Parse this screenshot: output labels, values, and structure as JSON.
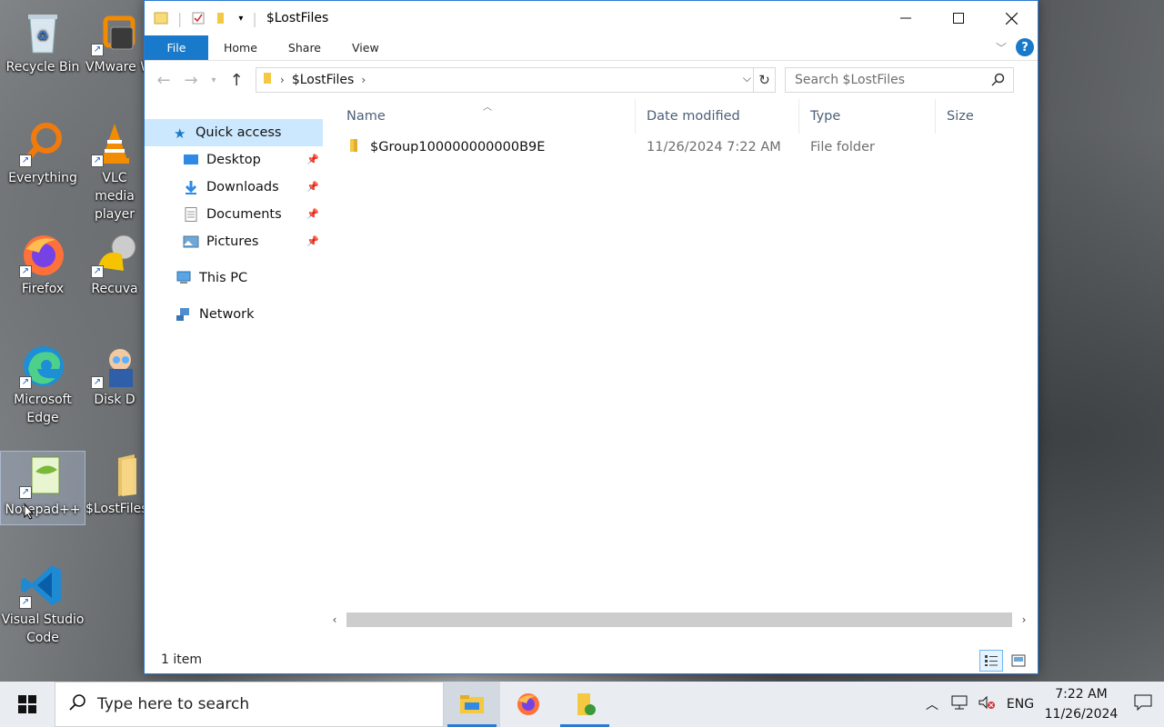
{
  "desktop": {
    "icons": [
      {
        "label": "Recycle Bin"
      },
      {
        "label": "VMware Workstation"
      },
      {
        "label": "Everything"
      },
      {
        "label": "VLC media player"
      },
      {
        "label": "Firefox"
      },
      {
        "label": "Recuva"
      },
      {
        "label": "Microsoft Edge"
      },
      {
        "label": "Disk D"
      },
      {
        "label": "Notepad++"
      },
      {
        "label": "$LostFiles"
      },
      {
        "label": "Visual Studio Code"
      }
    ]
  },
  "window": {
    "title": "$LostFiles",
    "ribbon_tabs": [
      "File",
      "Home",
      "Share",
      "View"
    ],
    "address": {
      "crumb": "$LostFiles"
    },
    "search_placeholder": "Search $LostFiles",
    "nav": {
      "quick_access": "Quick access",
      "pinned": [
        "Desktop",
        "Downloads",
        "Documents",
        "Pictures"
      ],
      "this_pc": "This PC",
      "network": "Network"
    },
    "columns": [
      "Name",
      "Date modified",
      "Type",
      "Size"
    ],
    "files": [
      {
        "name": "$Group100000000000B9E",
        "date": "11/26/2024 7:22 AM",
        "type": "File folder",
        "size": ""
      }
    ],
    "status": "1 item"
  },
  "taskbar": {
    "search_placeholder": "Type here to search",
    "language": "ENG",
    "time": "7:22 AM",
    "date": "11/26/2024"
  },
  "colors": {
    "accent": "#1979ca",
    "selection": "#cce8ff",
    "folder": "#f5c842"
  }
}
